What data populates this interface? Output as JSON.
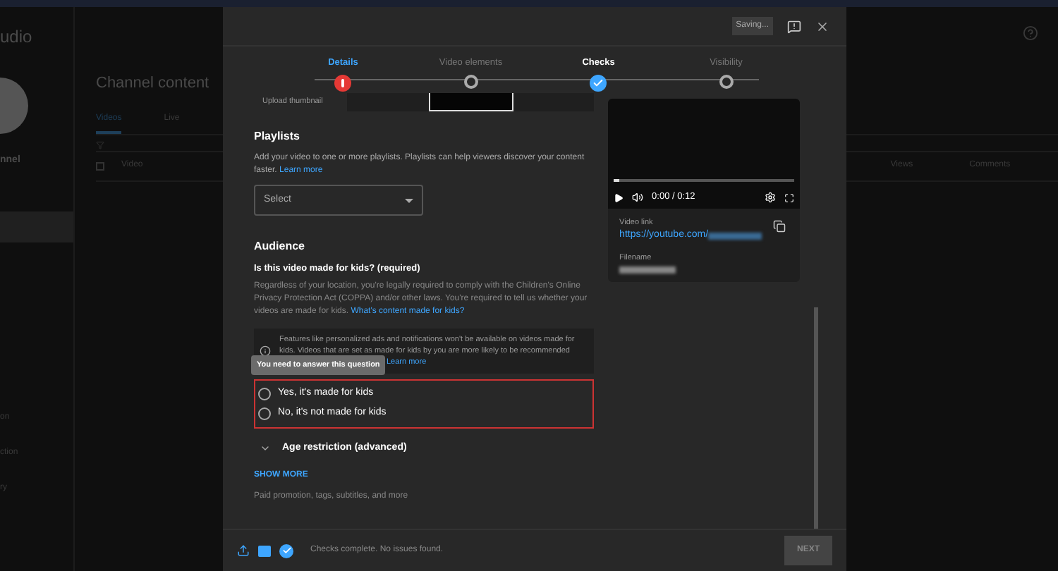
{
  "background": {
    "logo_text": "udio",
    "channel_name": "nnel",
    "page_title": "Channel content",
    "tabs": [
      {
        "label": "Videos",
        "selected": true
      },
      {
        "label": "Live",
        "selected": false
      }
    ],
    "table_columns": [
      "Video",
      "Views",
      "Comments"
    ],
    "select_all_checked": false,
    "sidebar_items": [
      "on",
      "ction",
      "ry"
    ]
  },
  "dialog": {
    "saving_label": "Saving...",
    "steps": [
      {
        "label": "Details",
        "kind": "error",
        "selected": true
      },
      {
        "label": "Video elements",
        "kind": "pending",
        "selected": false
      },
      {
        "label": "Checks",
        "kind": "done",
        "selected": false
      },
      {
        "label": "Visibility",
        "kind": "pending",
        "selected": false
      }
    ],
    "thumbnail_label": "Upload thumbnail",
    "playlists": {
      "heading": "Playlists",
      "description": "Add your video to one or more playlists. Playlists can help viewers discover your content faster.",
      "link": "Learn more",
      "select_placeholder": "Select"
    },
    "audience": {
      "heading": "Audience",
      "question": "Is this video made for kids? (required)",
      "description": "Regardless of your location, you're legally required to comply with the Children's Online Privacy Protection Act (COPPA) and/or other laws. You're required to tell us whether your videos are made for kids.",
      "link": "What's content made for kids?",
      "info": "Features like personalized ads and notifications won't be available on videos made for kids. Videos that are set as made for kids by you are more likely to be recommended",
      "info_link": "Learn more",
      "tooltip": "You need to answer this question",
      "options": [
        {
          "label": "Yes, it's made for kids",
          "selected": false
        },
        {
          "label": "No, it's not made for kids",
          "selected": false
        }
      ],
      "error": true
    },
    "age_restriction": {
      "label": "Age restriction (advanced)",
      "expanded": false
    },
    "show_more": "SHOW MORE",
    "show_more_hint": "Paid promotion, tags, subtitles, and more",
    "player": {
      "time": "0:00 / 0:12",
      "level": 0.03
    },
    "video_link_label": "Video link",
    "video_link": "https://youtube.com/",
    "filename_label": "Filename",
    "status": "Checks complete. No issues found.",
    "next_button": {
      "label": "NEXT",
      "disabled": true
    }
  }
}
